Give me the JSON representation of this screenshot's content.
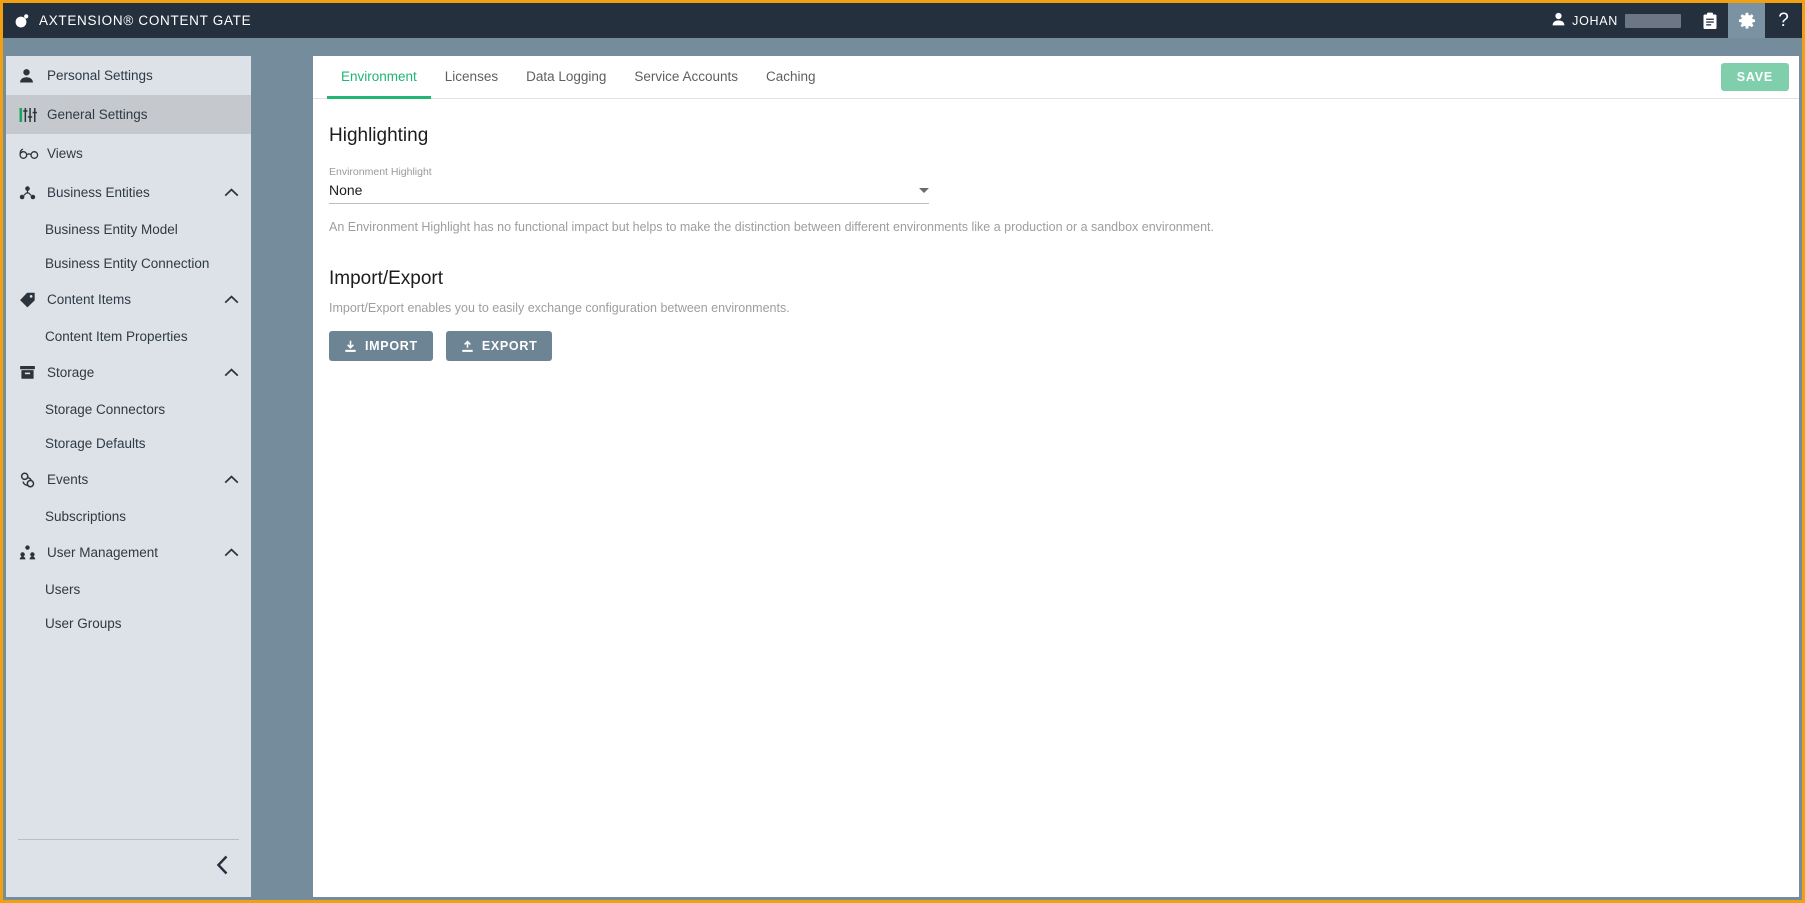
{
  "header": {
    "logo_icon": "axtension-logo-icon",
    "title": "AXTENSION® CONTENT GATE",
    "user": {
      "icon": "user-icon",
      "name": "JOHAN",
      "redacted": ""
    },
    "actions": [
      {
        "icon": "clipboard-icon",
        "name": "clipboard-button",
        "active": false
      },
      {
        "icon": "gear-icon",
        "name": "settings-button",
        "active": true
      },
      {
        "icon": "question-mark-icon",
        "name": "help-button",
        "active": false,
        "glyph": "?"
      }
    ]
  },
  "sidebar": {
    "items": [
      {
        "label": "Personal Settings",
        "icon": "person-icon",
        "type": "item",
        "selected": false,
        "expandable": false
      },
      {
        "label": "General Settings",
        "icon": "sliders-icon",
        "type": "item",
        "selected": true,
        "expandable": false
      },
      {
        "label": "Views",
        "icon": "glasses-icon",
        "type": "item",
        "selected": false,
        "expandable": false
      },
      {
        "label": "Business Entities",
        "icon": "hierarchy-icon",
        "type": "group",
        "selected": false,
        "expandable": true
      },
      {
        "label": "Business Entity Model",
        "type": "sub"
      },
      {
        "label": "Business Entity Connection",
        "type": "sub"
      },
      {
        "label": "Content Items",
        "icon": "tag-icon",
        "type": "group",
        "selected": false,
        "expandable": true
      },
      {
        "label": "Content Item Properties",
        "type": "sub"
      },
      {
        "label": "Storage",
        "icon": "archive-icon",
        "type": "group",
        "selected": false,
        "expandable": true
      },
      {
        "label": "Storage Connectors",
        "type": "sub"
      },
      {
        "label": "Storage Defaults",
        "type": "sub"
      },
      {
        "label": "Events",
        "icon": "webhook-icon",
        "type": "group",
        "selected": false,
        "expandable": true
      },
      {
        "label": "Subscriptions",
        "type": "sub"
      },
      {
        "label": "User Management",
        "icon": "people-icon",
        "type": "group",
        "selected": false,
        "expandable": true
      },
      {
        "label": "Users",
        "type": "sub"
      },
      {
        "label": "User Groups",
        "type": "sub"
      }
    ],
    "collapse_icon": "chevron-left-icon"
  },
  "tabs": [
    {
      "label": "Environment",
      "active": true
    },
    {
      "label": "Licenses",
      "active": false
    },
    {
      "label": "Data Logging",
      "active": false
    },
    {
      "label": "Service Accounts",
      "active": false
    },
    {
      "label": "Caching",
      "active": false
    }
  ],
  "toolbar": {
    "save_label": "SAVE"
  },
  "main": {
    "highlighting": {
      "title": "Highlighting",
      "field_label": "Environment Highlight",
      "field_value": "None",
      "helper": "An Environment Highlight has no functional impact but helps to make the distinction between different environments like a production or a sandbox environment."
    },
    "import_export": {
      "title": "Import/Export",
      "description": "Import/Export enables you to easily exchange configuration between environments.",
      "import_label": "IMPORT",
      "export_label": "EXPORT"
    }
  },
  "colors": {
    "header_bg": "#25303f",
    "page_border": "#f0a011",
    "band": "#748c9b",
    "sidebar_bg": "#dde1e8",
    "sidebar_selected": "#c5c9cd",
    "accent_green": "#22b573",
    "save_green": "#7fcfad",
    "button_slate": "#6c8494"
  }
}
